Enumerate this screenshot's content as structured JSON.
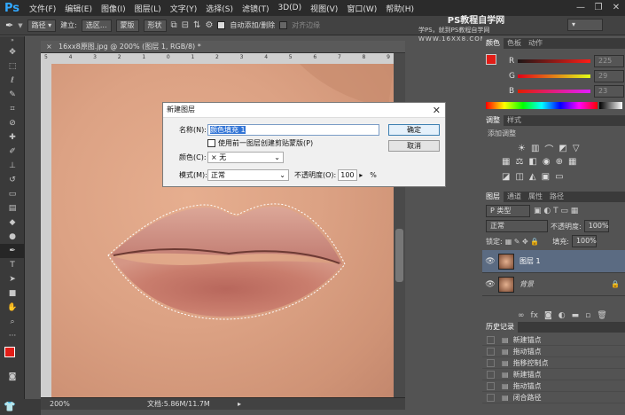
{
  "app": {
    "logo": "Ps"
  },
  "menu": [
    "文件(F)",
    "编辑(E)",
    "图像(I)",
    "图层(L)",
    "文字(Y)",
    "选择(S)",
    "滤镜(T)",
    "3D(D)",
    "视图(V)",
    "窗口(W)",
    "帮助(H)"
  ],
  "window_controls": [
    "—",
    "❐",
    "✕"
  ],
  "options_bar": {
    "mode_select": "路径",
    "make_label": "建立:",
    "selection_btn": "选区...",
    "mask_btn": "蒙版",
    "shape_btn": "形状",
    "auto_add_delete": "自动添加/删除",
    "align_edges": "对齐边缘"
  },
  "watermark": {
    "line1": "PS教程自学网",
    "line2": "学PS，就到PS教程自学网",
    "line3": "WWW.16XX8.COM"
  },
  "document": {
    "tab_title": "16xx8原图.jpg @ 200% (图层 1, RGB/8) *",
    "zoom": "200%",
    "doc_size": "文档:5.86M/11.7M"
  },
  "ruler_marks": [
    "5",
    "4",
    "3",
    "2",
    "1",
    "0",
    "1",
    "2",
    "3",
    "4",
    "5",
    "6",
    "7",
    "8",
    "9"
  ],
  "dialog": {
    "title": "新建图层",
    "name_label": "名称(N):",
    "name_value": "颜色填充 1",
    "clip_label": "使用前一图层创建剪贴蒙版(P)",
    "color_label": "颜色(C):",
    "color_value": "无",
    "mode_label": "模式(M):",
    "mode_value": "正常",
    "opacity_label": "不透明度(O):",
    "opacity_value": "100",
    "opacity_unit": "%",
    "ok": "确定",
    "cancel": "取消"
  },
  "color_panel": {
    "tabs": [
      "颜色",
      "色板",
      "动作"
    ],
    "r_label": "R",
    "g_label": "G",
    "b_label": "B",
    "r_value": "225",
    "g_value": "29",
    "b_value": "23",
    "fg_color": "#e11d17"
  },
  "adjust_panel": {
    "tabs": [
      "调整",
      "样式"
    ],
    "add_label": "添加调整"
  },
  "layers_panel": {
    "tabs": [
      "图层",
      "通道",
      "属性",
      "路径"
    ],
    "filter_label": "P 类型",
    "blend_mode": "正常",
    "opacity_label": "不透明度:",
    "opacity_value": "100%",
    "lock_label": "锁定:",
    "fill_label": "填充:",
    "fill_value": "100%",
    "layers": [
      {
        "name": "图层 1",
        "selected": true
      },
      {
        "name": "背景",
        "selected": false
      }
    ]
  },
  "history_panel": {
    "title": "历史记录",
    "items": [
      "新建锚点",
      "拖动锚点",
      "拖移控制点",
      "新建锚点",
      "拖动锚点",
      "闭合路径"
    ]
  }
}
